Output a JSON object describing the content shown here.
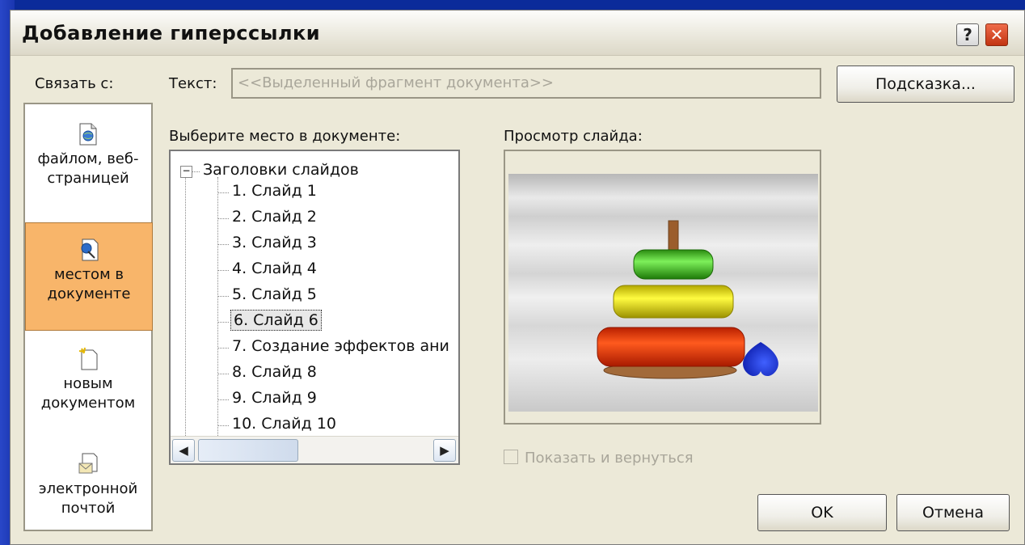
{
  "dialog": {
    "title": "Добавление гиперссылки",
    "help_label": "?",
    "close_label": "✕"
  },
  "link_to": {
    "label": "Связать с:",
    "places": [
      {
        "label": "файлом, веб-страницей",
        "icon": "file-web-icon",
        "selected": false
      },
      {
        "label": "местом в документе",
        "icon": "place-in-document-icon",
        "selected": true
      },
      {
        "label": "новым документом",
        "icon": "new-document-icon",
        "selected": false
      },
      {
        "label": "электронной почтой",
        "icon": "email-icon",
        "selected": false
      }
    ]
  },
  "text_field": {
    "label": "Текст:",
    "value": "<<Выделенный фрагмент документа>>"
  },
  "tooltip_button": "Подсказка...",
  "place_list": {
    "label": "Выберите место в документе:",
    "root": "Заголовки слайдов",
    "items": [
      "1. Слайд 1",
      "2. Слайд 2",
      "3. Слайд 3",
      "4. Слайд 4",
      "5. Слайд 5",
      "6. Слайд 6",
      "7. Создание эффектов ани",
      "8. Слайд 8",
      "9. Слайд 9",
      "10. Слайд 10"
    ],
    "selected_index": 5
  },
  "preview": {
    "label": "Просмотр слайда:"
  },
  "show_and_return": {
    "label": "Показать и вернуться",
    "checked": false,
    "enabled": false
  },
  "ok_button": "OK",
  "cancel_button": "Отмена",
  "colors": {
    "selected_place_bg": "#f8b56a",
    "dialog_bg": "#ece9d8",
    "desktop_bg": "#0b2b9a"
  }
}
